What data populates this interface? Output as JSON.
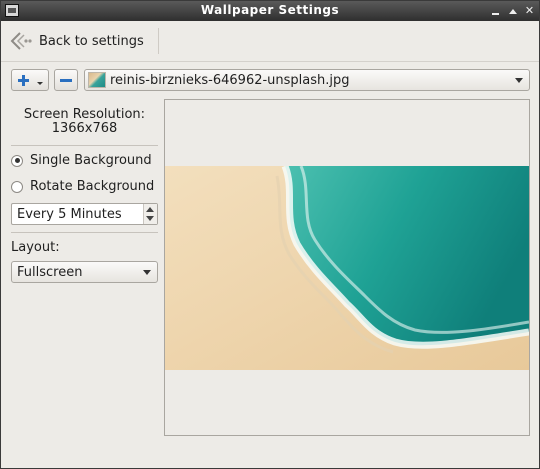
{
  "window": {
    "title": "Wallpaper Settings"
  },
  "header": {
    "back_label": "Back to settings"
  },
  "toolbar": {
    "selected_file": "reinis-birznieks-646962-unsplash.jpg"
  },
  "settings": {
    "resolution_label": "Screen Resolution:",
    "resolution_value": "1366x768",
    "mode_options": [
      {
        "label": "Single Background",
        "selected": true
      },
      {
        "label": "Rotate Background",
        "selected": false
      }
    ],
    "interval_value": "Every 5 Minutes",
    "layout_label": "Layout:",
    "layout_value": "Fullscreen"
  },
  "colors": {
    "accent": "#2a6fc0",
    "titlebar": "#3a3a3a",
    "sea": "#1f9a8f",
    "sand": "#edd2a6"
  },
  "icons": [
    "app-icon",
    "minimize-icon",
    "maximize-icon",
    "close-icon",
    "back-arrow-icon",
    "plus-icon",
    "minus-icon",
    "chevron-down-icon",
    "spin-up-icon",
    "spin-down-icon"
  ]
}
